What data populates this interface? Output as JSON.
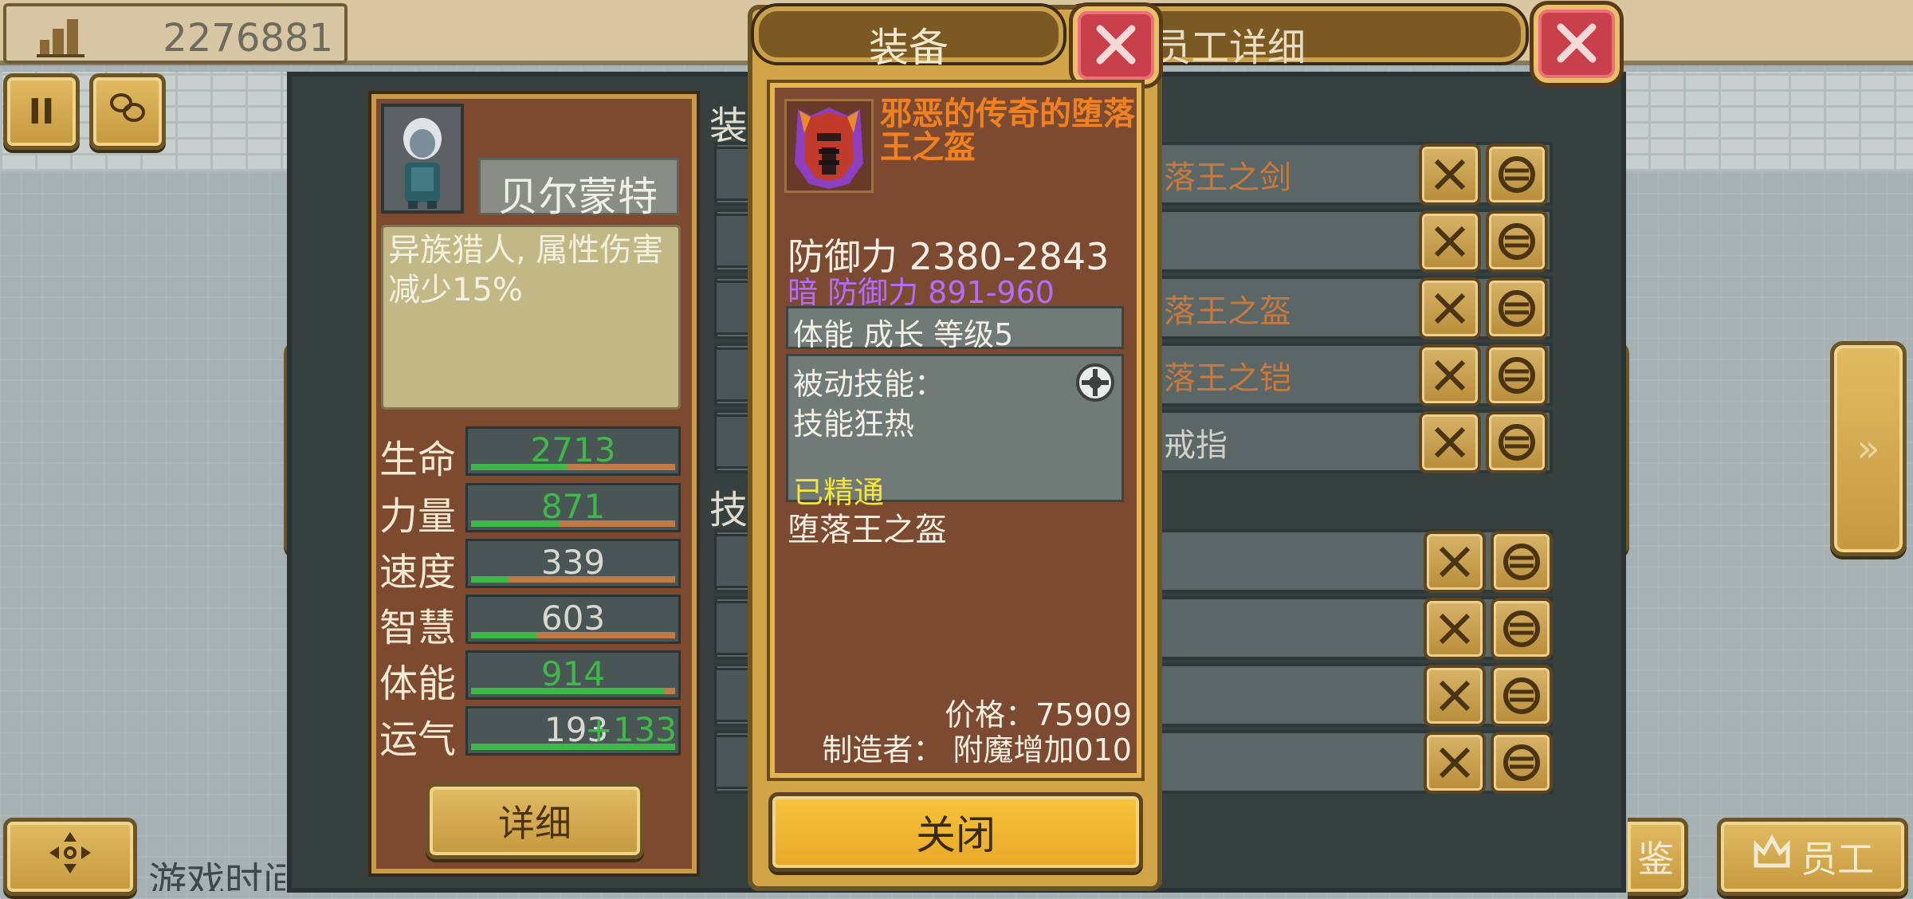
{
  "topbar": {
    "money": "2276881"
  },
  "bottom": {
    "game_time_label": "游戏时间",
    "right_btn1_label": "鉴",
    "right_btn2_label": "员工"
  },
  "employee_panel": {
    "header": "员工详细",
    "name": "贝尔蒙特",
    "trait": "异族猎人, 属性伤害减少15%",
    "section_equip": "装",
    "section_skill": "技",
    "stats": [
      {
        "label": "生命",
        "value": "2713",
        "fill": 0.47,
        "color": "#3fb84a"
      },
      {
        "label": "力量",
        "value": "871",
        "fill": 0.43,
        "color": "#3fb84a"
      },
      {
        "label": "速度",
        "value": "339",
        "fill": 0.18,
        "color": "#d8d8d0"
      },
      {
        "label": "智慧",
        "value": "603",
        "fill": 0.32,
        "color": "#d8d8d0"
      },
      {
        "label": "体能",
        "value": "914",
        "fill": 0.95,
        "color": "#3fb84a"
      },
      {
        "label": "运气",
        "value": "193",
        "bonus": "+133",
        "fill": 1.0,
        "color": "#d8d8d0"
      }
    ],
    "detail_btn": "详细",
    "equip_slots": [
      {
        "text": "落王之剑",
        "color": "#c9793c"
      },
      {
        "text": "",
        "color": "#d0d0c8"
      },
      {
        "text": "落王之盔",
        "color": "#c9793c"
      },
      {
        "text": "落王之铠",
        "color": "#c9793c"
      },
      {
        "text": "戒指",
        "color": "#d0d0c8"
      }
    ]
  },
  "equip_popup": {
    "title": "装备",
    "item_name": "邪恶的传奇的堕落王之盔",
    "defense": "防御力 2380-2843",
    "dark_defense": "暗 防御力 891-960",
    "growth": "体能 成长 等级5",
    "passive_title": "被动技能：",
    "passive_skill": "技能狂热",
    "mastered": "已精通",
    "base_name": "堕落王之盔",
    "price": "价格：75909",
    "maker": "制造者： 附魔增加010",
    "close_btn": "关闭"
  },
  "colors": {
    "legendary_orange": "#f08020",
    "dark_purple": "#b46cff",
    "mastered_yellow": "#f5e43a",
    "stat_green": "#3fb84a"
  }
}
